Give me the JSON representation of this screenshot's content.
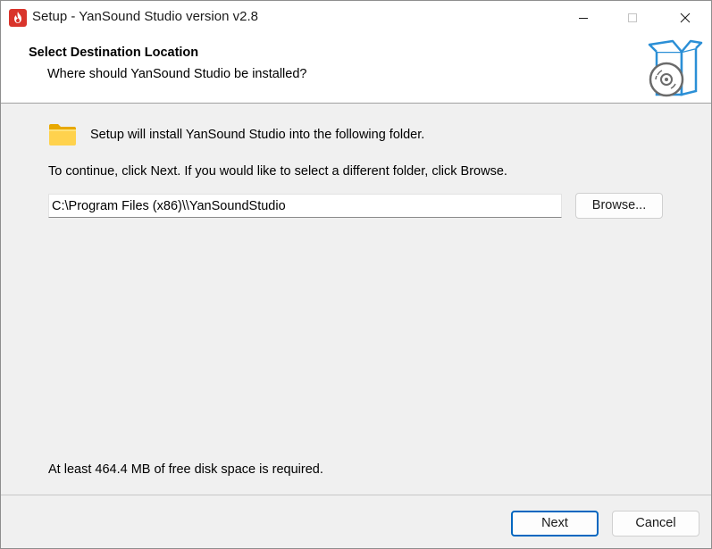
{
  "window": {
    "title": "Setup - YanSound Studio version v2.8",
    "app_icon": "installer-flame-icon",
    "controls": {
      "minimize_icon": "minimize-icon",
      "maximize_icon": "maximize-icon",
      "close_icon": "close-icon"
    }
  },
  "header": {
    "title": "Select Destination Location",
    "subtitle": "Where should YanSound Studio be installed?",
    "icon": "install-box-disc-icon"
  },
  "body": {
    "folder_icon": "folder-icon",
    "intro": "Setup will install YanSound Studio into the following folder.",
    "instruction": "To continue, click Next. If you would like to select a different folder, click Browse.",
    "path_value": "C:\\Program Files (x86)\\\\YanSoundStudio",
    "browse_label": "Browse...",
    "disk_space": "At least 464.4 MB of free disk space is required."
  },
  "footer": {
    "next_label": "Next",
    "cancel_label": "Cancel"
  },
  "colors": {
    "accent": "#0067c0",
    "app_icon_bg": "#d9342b",
    "window_bg": "#f0f0f0",
    "header_icon_blue": "#2b8fd6"
  }
}
